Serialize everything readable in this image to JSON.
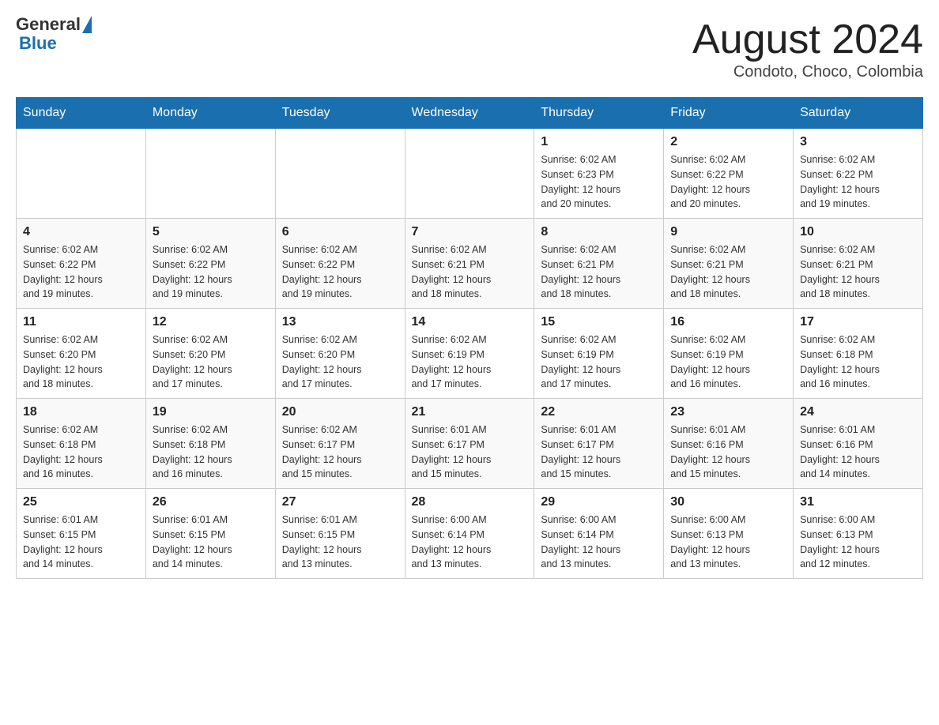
{
  "header": {
    "logo_general": "General",
    "logo_blue": "Blue",
    "month_title": "August 2024",
    "location": "Condoto, Choco, Colombia"
  },
  "weekdays": [
    "Sunday",
    "Monday",
    "Tuesday",
    "Wednesday",
    "Thursday",
    "Friday",
    "Saturday"
  ],
  "weeks": [
    [
      {
        "day": "",
        "info": ""
      },
      {
        "day": "",
        "info": ""
      },
      {
        "day": "",
        "info": ""
      },
      {
        "day": "",
        "info": ""
      },
      {
        "day": "1",
        "info": "Sunrise: 6:02 AM\nSunset: 6:23 PM\nDaylight: 12 hours\nand 20 minutes."
      },
      {
        "day": "2",
        "info": "Sunrise: 6:02 AM\nSunset: 6:22 PM\nDaylight: 12 hours\nand 20 minutes."
      },
      {
        "day": "3",
        "info": "Sunrise: 6:02 AM\nSunset: 6:22 PM\nDaylight: 12 hours\nand 19 minutes."
      }
    ],
    [
      {
        "day": "4",
        "info": "Sunrise: 6:02 AM\nSunset: 6:22 PM\nDaylight: 12 hours\nand 19 minutes."
      },
      {
        "day": "5",
        "info": "Sunrise: 6:02 AM\nSunset: 6:22 PM\nDaylight: 12 hours\nand 19 minutes."
      },
      {
        "day": "6",
        "info": "Sunrise: 6:02 AM\nSunset: 6:22 PM\nDaylight: 12 hours\nand 19 minutes."
      },
      {
        "day": "7",
        "info": "Sunrise: 6:02 AM\nSunset: 6:21 PM\nDaylight: 12 hours\nand 18 minutes."
      },
      {
        "day": "8",
        "info": "Sunrise: 6:02 AM\nSunset: 6:21 PM\nDaylight: 12 hours\nand 18 minutes."
      },
      {
        "day": "9",
        "info": "Sunrise: 6:02 AM\nSunset: 6:21 PM\nDaylight: 12 hours\nand 18 minutes."
      },
      {
        "day": "10",
        "info": "Sunrise: 6:02 AM\nSunset: 6:21 PM\nDaylight: 12 hours\nand 18 minutes."
      }
    ],
    [
      {
        "day": "11",
        "info": "Sunrise: 6:02 AM\nSunset: 6:20 PM\nDaylight: 12 hours\nand 18 minutes."
      },
      {
        "day": "12",
        "info": "Sunrise: 6:02 AM\nSunset: 6:20 PM\nDaylight: 12 hours\nand 17 minutes."
      },
      {
        "day": "13",
        "info": "Sunrise: 6:02 AM\nSunset: 6:20 PM\nDaylight: 12 hours\nand 17 minutes."
      },
      {
        "day": "14",
        "info": "Sunrise: 6:02 AM\nSunset: 6:19 PM\nDaylight: 12 hours\nand 17 minutes."
      },
      {
        "day": "15",
        "info": "Sunrise: 6:02 AM\nSunset: 6:19 PM\nDaylight: 12 hours\nand 17 minutes."
      },
      {
        "day": "16",
        "info": "Sunrise: 6:02 AM\nSunset: 6:19 PM\nDaylight: 12 hours\nand 16 minutes."
      },
      {
        "day": "17",
        "info": "Sunrise: 6:02 AM\nSunset: 6:18 PM\nDaylight: 12 hours\nand 16 minutes."
      }
    ],
    [
      {
        "day": "18",
        "info": "Sunrise: 6:02 AM\nSunset: 6:18 PM\nDaylight: 12 hours\nand 16 minutes."
      },
      {
        "day": "19",
        "info": "Sunrise: 6:02 AM\nSunset: 6:18 PM\nDaylight: 12 hours\nand 16 minutes."
      },
      {
        "day": "20",
        "info": "Sunrise: 6:02 AM\nSunset: 6:17 PM\nDaylight: 12 hours\nand 15 minutes."
      },
      {
        "day": "21",
        "info": "Sunrise: 6:01 AM\nSunset: 6:17 PM\nDaylight: 12 hours\nand 15 minutes."
      },
      {
        "day": "22",
        "info": "Sunrise: 6:01 AM\nSunset: 6:17 PM\nDaylight: 12 hours\nand 15 minutes."
      },
      {
        "day": "23",
        "info": "Sunrise: 6:01 AM\nSunset: 6:16 PM\nDaylight: 12 hours\nand 15 minutes."
      },
      {
        "day": "24",
        "info": "Sunrise: 6:01 AM\nSunset: 6:16 PM\nDaylight: 12 hours\nand 14 minutes."
      }
    ],
    [
      {
        "day": "25",
        "info": "Sunrise: 6:01 AM\nSunset: 6:15 PM\nDaylight: 12 hours\nand 14 minutes."
      },
      {
        "day": "26",
        "info": "Sunrise: 6:01 AM\nSunset: 6:15 PM\nDaylight: 12 hours\nand 14 minutes."
      },
      {
        "day": "27",
        "info": "Sunrise: 6:01 AM\nSunset: 6:15 PM\nDaylight: 12 hours\nand 13 minutes."
      },
      {
        "day": "28",
        "info": "Sunrise: 6:00 AM\nSunset: 6:14 PM\nDaylight: 12 hours\nand 13 minutes."
      },
      {
        "day": "29",
        "info": "Sunrise: 6:00 AM\nSunset: 6:14 PM\nDaylight: 12 hours\nand 13 minutes."
      },
      {
        "day": "30",
        "info": "Sunrise: 6:00 AM\nSunset: 6:13 PM\nDaylight: 12 hours\nand 13 minutes."
      },
      {
        "day": "31",
        "info": "Sunrise: 6:00 AM\nSunset: 6:13 PM\nDaylight: 12 hours\nand 12 minutes."
      }
    ]
  ]
}
